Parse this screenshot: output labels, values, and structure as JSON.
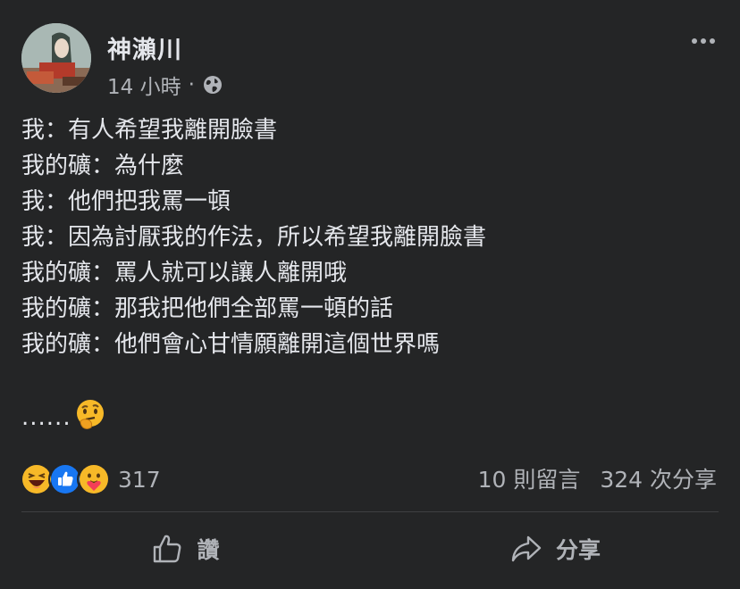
{
  "post": {
    "author": "神瀨川",
    "time": "14 小時",
    "separator": "·",
    "privacy_icon": "globe-icon",
    "lines": [
      "我：有人希望我離開臉書",
      "我的礦：為什麼",
      "我：他們把我罵一頓",
      "我：因為討厭我的作法，所以希望我離開臉書",
      "我的礦：罵人就可以讓人離開哦",
      "我的礦：那我把他們全部罵一頓的話",
      "我的礦：他們會心甘情願離開這個世界嗎"
    ],
    "ellipsis": "......",
    "ellipsis_emoji": "thinking-face-icon"
  },
  "reactions": {
    "icons": [
      "haha-icon",
      "like-icon",
      "care-icon"
    ],
    "count": "317"
  },
  "stats": {
    "comments": "10 則留言",
    "shares": "324 次分享"
  },
  "actions": {
    "like_label": "讚",
    "share_label": "分享"
  },
  "colors": {
    "background": "#242526",
    "text": "#e4e6eb",
    "secondary": "#b0b3b8",
    "like_blue": "#1877f2",
    "haha_yellow": "#f7b928"
  }
}
